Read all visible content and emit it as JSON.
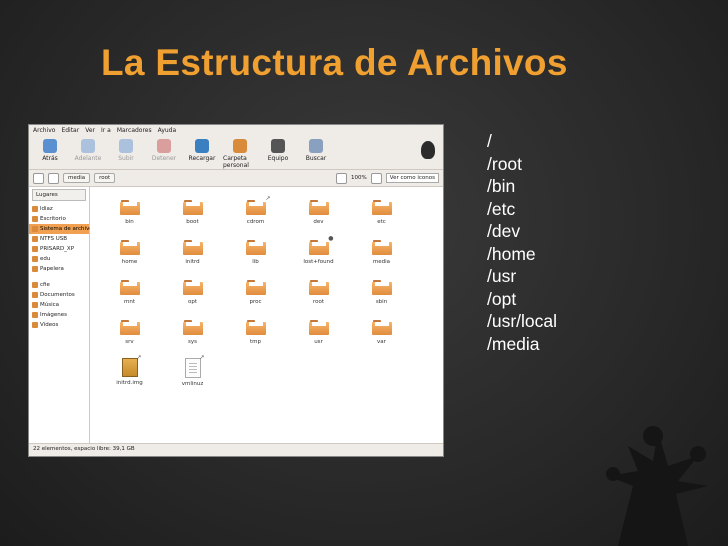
{
  "slide": {
    "title": "La Estructura de Archivos",
    "bullets": [
      "/",
      "/root",
      "/bin",
      "/etc",
      "/dev",
      "/home",
      "/usr",
      "/opt",
      "/usr/local",
      "/media"
    ]
  },
  "window": {
    "menu": [
      "Archivo",
      "Editar",
      "Ver",
      "Ir a",
      "Marcadores",
      "Ayuda"
    ],
    "toolbar": [
      {
        "label": "Atrás",
        "icon": "back-arrow-icon",
        "enabled": true
      },
      {
        "label": "Adelante",
        "icon": "forward-arrow-icon",
        "enabled": false
      },
      {
        "label": "Subir",
        "icon": "up-arrow-icon",
        "enabled": false
      },
      {
        "label": "Detener",
        "icon": "stop-icon",
        "enabled": false
      },
      {
        "label": "Recargar",
        "icon": "reload-icon",
        "enabled": true
      },
      {
        "label": "Carpeta personal",
        "icon": "home-folder-icon",
        "enabled": true
      },
      {
        "label": "Equipo",
        "icon": "computer-icon",
        "enabled": true
      },
      {
        "label": "Buscar",
        "icon": "search-icon",
        "enabled": true
      }
    ],
    "location": {
      "paths": [
        "media",
        "root"
      ],
      "zoom": "100%",
      "view": "Ver como iconos"
    },
    "sidebar": {
      "header": "Lugares",
      "items": [
        "ldiaz",
        "Escritorio",
        "Sistema de archivos",
        "NTFS USB",
        "PRISARD_XP",
        "edu",
        "Papelera",
        "cfie",
        "Documentos",
        "Música",
        "Imágenes",
        "Vídeos"
      ]
    },
    "files": [
      {
        "name": "bin",
        "type": "folder"
      },
      {
        "name": "boot",
        "type": "folder"
      },
      {
        "name": "cdrom",
        "type": "folder",
        "badge": "↗"
      },
      {
        "name": "dev",
        "type": "folder"
      },
      {
        "name": "etc",
        "type": "folder"
      },
      {
        "name": "home",
        "type": "folder"
      },
      {
        "name": "initrd",
        "type": "folder"
      },
      {
        "name": "lib",
        "type": "folder"
      },
      {
        "name": "lost+found",
        "type": "folder",
        "badge": "●"
      },
      {
        "name": "media",
        "type": "folder"
      },
      {
        "name": "mnt",
        "type": "folder"
      },
      {
        "name": "opt",
        "type": "folder"
      },
      {
        "name": "proc",
        "type": "folder"
      },
      {
        "name": "root",
        "type": "folder"
      },
      {
        "name": "sbin",
        "type": "folder"
      },
      {
        "name": "srv",
        "type": "folder"
      },
      {
        "name": "sys",
        "type": "folder"
      },
      {
        "name": "tmp",
        "type": "folder"
      },
      {
        "name": "usr",
        "type": "folder"
      },
      {
        "name": "var",
        "type": "folder"
      },
      {
        "name": "initrd.img",
        "type": "package",
        "badge": "↗"
      },
      {
        "name": "vmlinuz",
        "type": "document",
        "badge": "↗"
      }
    ],
    "status": "22 elementos, espacio libre: 39,1 GB"
  },
  "colors": {
    "title": "#f0a030",
    "folder": "#e99a4a",
    "selected": "#f0a050",
    "background": "#2a2a2a"
  }
}
